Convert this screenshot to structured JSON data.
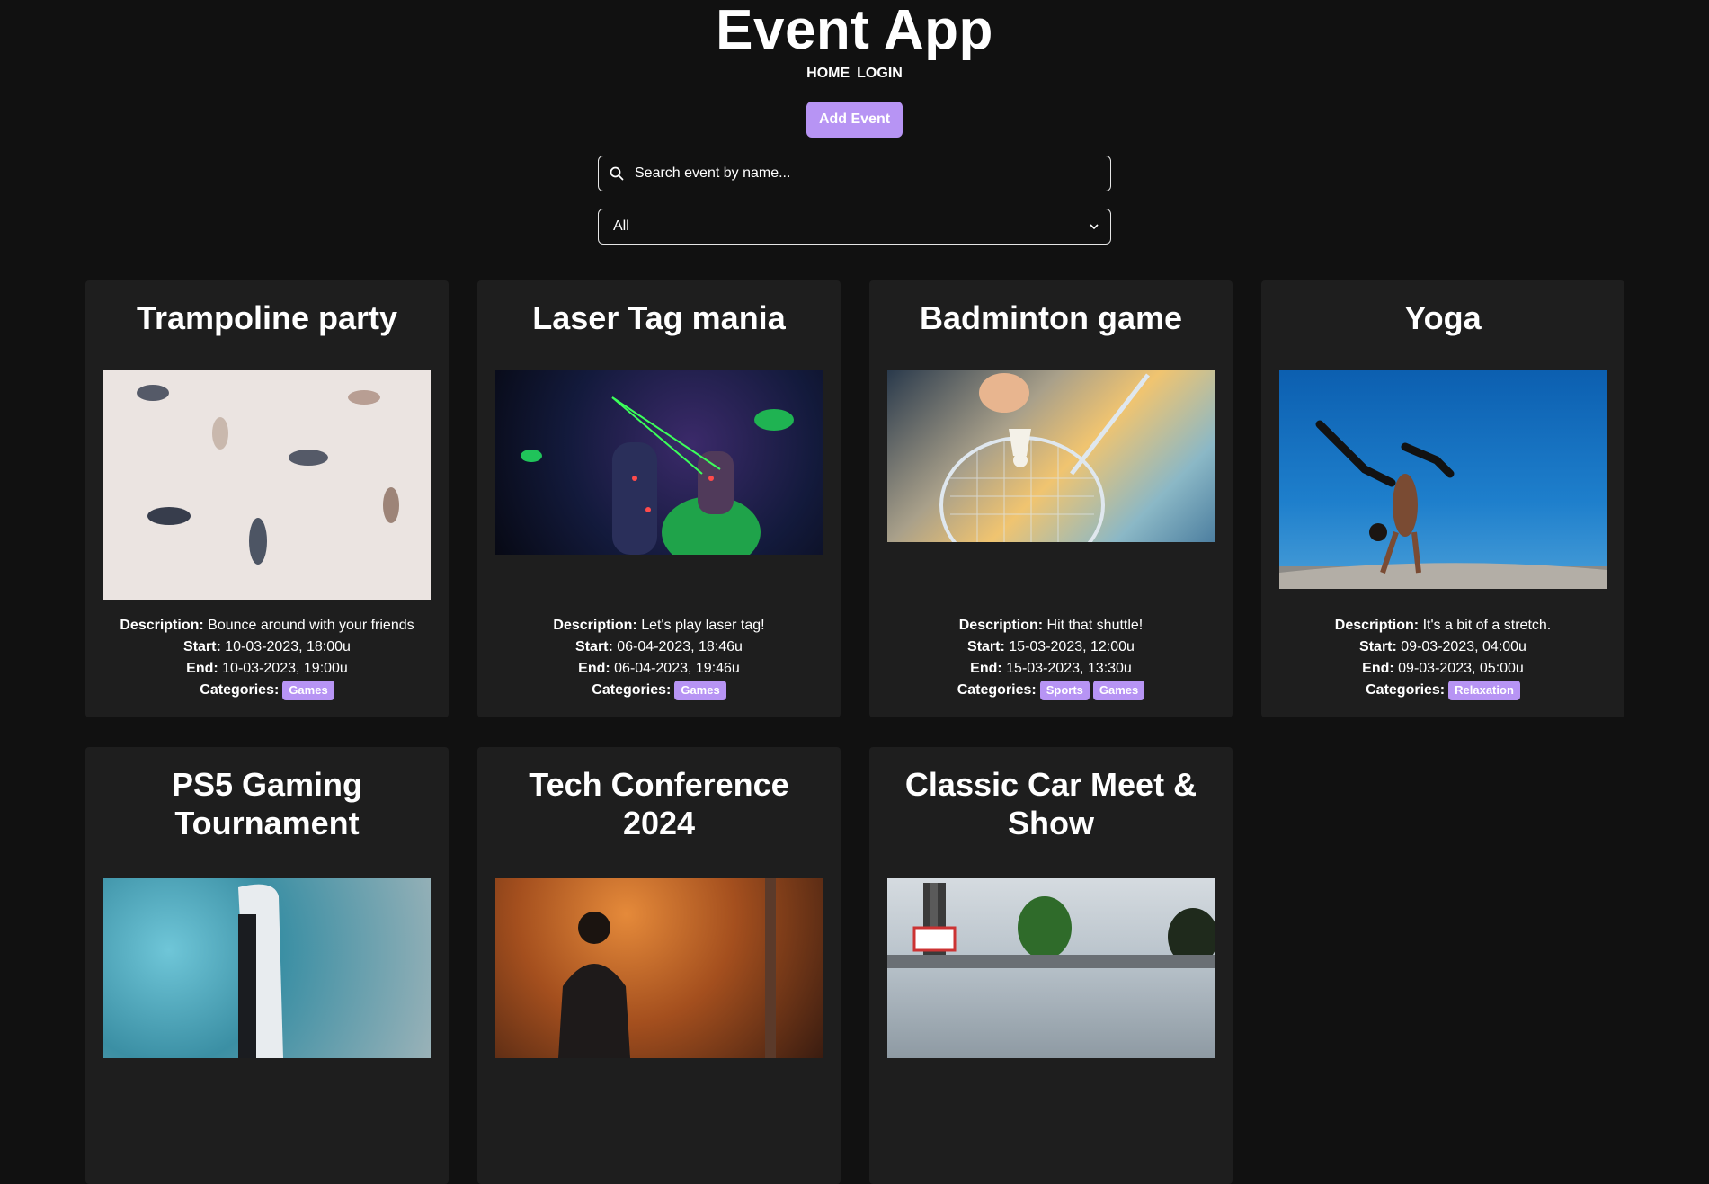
{
  "header": {
    "title": "Event App",
    "nav": [
      {
        "label": "HOME"
      },
      {
        "label": "LOGIN"
      }
    ],
    "add_event_label": "Add Event"
  },
  "search": {
    "placeholder": "Search event by name..."
  },
  "filter": {
    "selected": "All"
  },
  "colors": {
    "background": "#111111",
    "card": "#1e1e1e",
    "accent": "#b794f4"
  },
  "labels": {
    "description": "Description:",
    "start": "Start:",
    "end": "End:",
    "categories": "Categories:"
  },
  "events": [
    {
      "title": "Trampoline party",
      "description": "Bounce around with your friends",
      "start": "10-03-2023, 18:00u",
      "end": "10-03-2023, 19:00u",
      "categories": [
        "Games"
      ]
    },
    {
      "title": "Laser Tag mania",
      "description": "Let's play laser tag!",
      "start": "06-04-2023, 18:46u",
      "end": "06-04-2023, 19:46u",
      "categories": [
        "Games"
      ]
    },
    {
      "title": "Badminton game",
      "description": "Hit that shuttle!",
      "start": "15-03-2023, 12:00u",
      "end": "15-03-2023, 13:30u",
      "categories": [
        "Sports",
        "Games"
      ]
    },
    {
      "title": "Yoga",
      "description": "It's a bit of a stretch.",
      "start": "09-03-2023, 04:00u",
      "end": "09-03-2023, 05:00u",
      "categories": [
        "Relaxation"
      ]
    },
    {
      "title": "PS5 Gaming Tournament"
    },
    {
      "title": "Tech Conference 2024"
    },
    {
      "title": "Classic Car Meet & Show"
    }
  ]
}
